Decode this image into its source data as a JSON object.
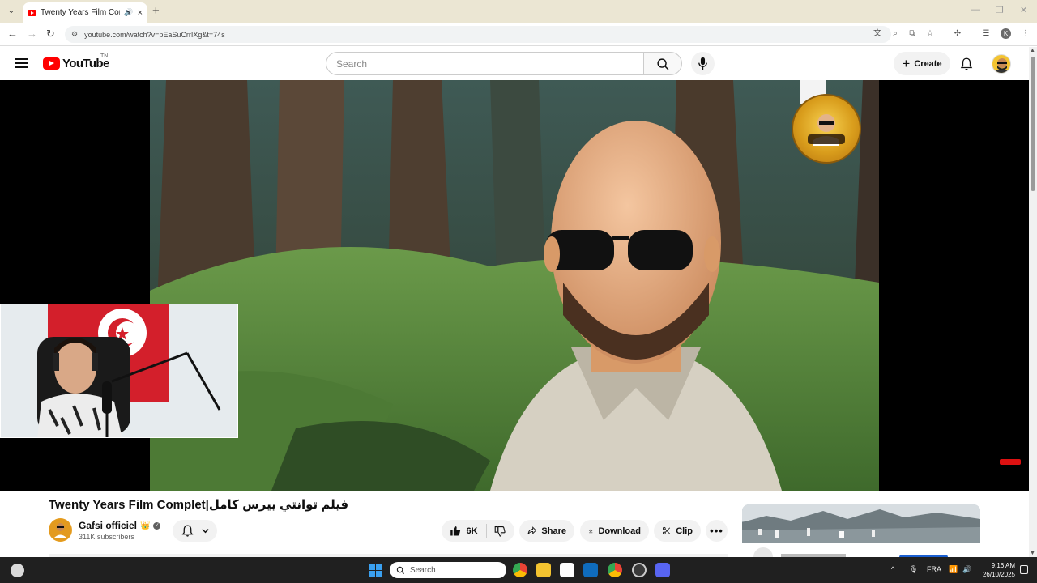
{
  "browser": {
    "tab_title": "Twenty Years Film Complet|",
    "tab_close": "×",
    "new_tab": "+",
    "url": "youtube.com/watch?v=pEaSuCrrIXg&t=74s",
    "win_minimize": "—",
    "win_restore": "❐",
    "win_close": "✕",
    "profile_initial": "K"
  },
  "youtube": {
    "logo_text": "YouTube",
    "logo_tm": "TN",
    "search_placeholder": "Search",
    "create_label": "Create"
  },
  "video": {
    "title": "Twenty Years Film Complet|فيلم توانتي ييرس كامل"
  },
  "channel": {
    "name": "Gafsi officiel",
    "crown": "👑",
    "verified": "✓",
    "subscribers": "311K subscribers"
  },
  "actions": {
    "likes": "6K",
    "share": "Share",
    "download": "Download",
    "clip": "Clip",
    "more": "•••"
  },
  "taskbar": {
    "search_placeholder": "Search",
    "language": "FRA",
    "time": "9:16 AM",
    "date": "26/10/2025"
  },
  "colors": {
    "youtube_red": "#ff0000",
    "taskbar": "#202020",
    "browser_tabbar": "#ebe6d3"
  }
}
